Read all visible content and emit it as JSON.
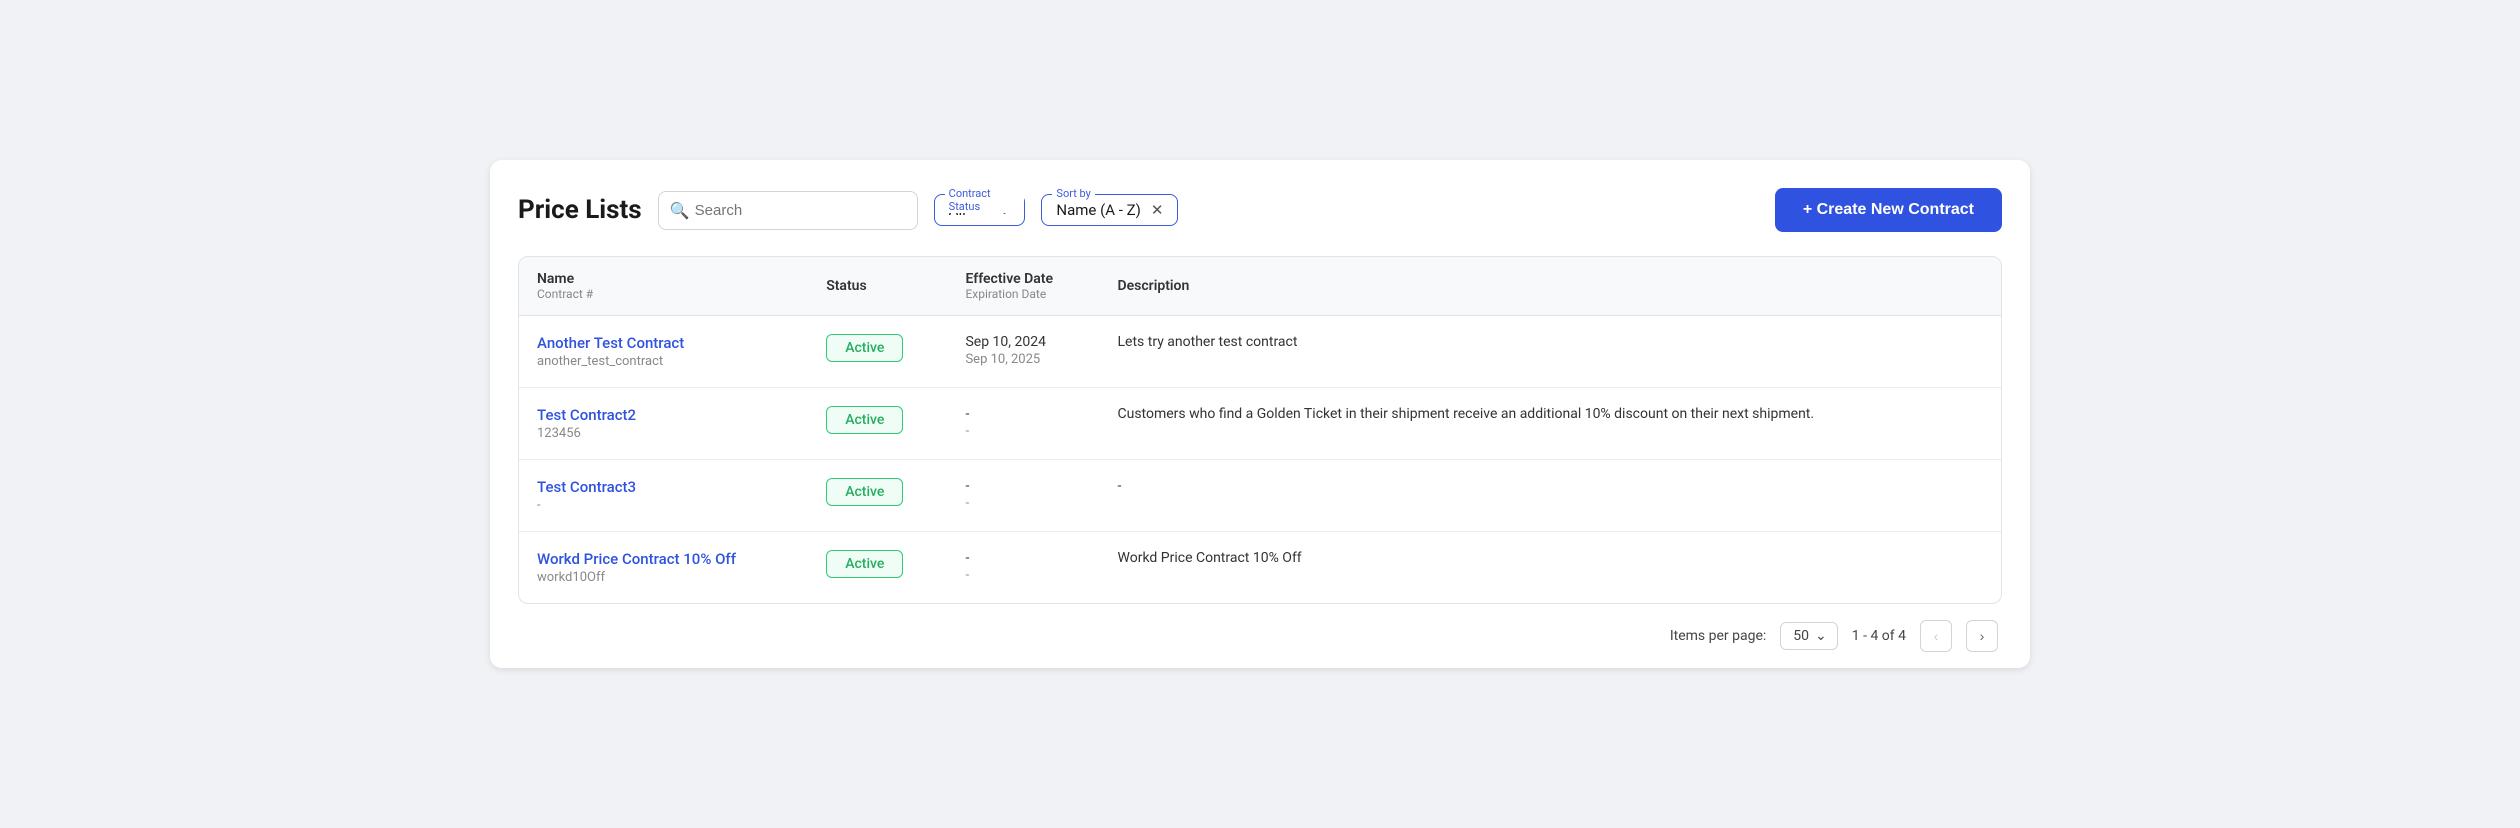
{
  "header": {
    "title": "Price Lists",
    "search_placeholder": "Search",
    "contract_status_label": "Contract Status",
    "contract_status_value": "All",
    "sort_by_label": "Sort by",
    "sort_by_value": "Name (A - Z)",
    "create_btn_label": "+ Create New Contract"
  },
  "table": {
    "columns": [
      {
        "header": "Name",
        "sub": "Contract #"
      },
      {
        "header": "Status",
        "sub": ""
      },
      {
        "header": "Effective Date",
        "sub": "Expiration Date"
      },
      {
        "header": "Description",
        "sub": ""
      }
    ],
    "rows": [
      {
        "name": "Another Test Contract",
        "number": "another_test_contract",
        "status": "Active",
        "effective_date": "Sep 10, 2024",
        "expiration_date": "Sep 10, 2025",
        "description": "Lets try another test contract"
      },
      {
        "name": "Test Contract2",
        "number": "123456",
        "status": "Active",
        "effective_date": "-",
        "expiration_date": "-",
        "description": "Customers who find a Golden Ticket in their shipment receive an additional 10% discount on their next shipment."
      },
      {
        "name": "Test Contract3",
        "number": "-",
        "status": "Active",
        "effective_date": "-",
        "expiration_date": "-",
        "description": "-"
      },
      {
        "name": "Workd Price Contract 10% Off",
        "number": "workd10Off",
        "status": "Active",
        "effective_date": "-",
        "expiration_date": "-",
        "description": "Workd Price Contract 10% Off"
      }
    ]
  },
  "footer": {
    "items_per_page_label": "Items per page:",
    "per_page_value": "50",
    "page_info": "1 - 4 of 4"
  }
}
